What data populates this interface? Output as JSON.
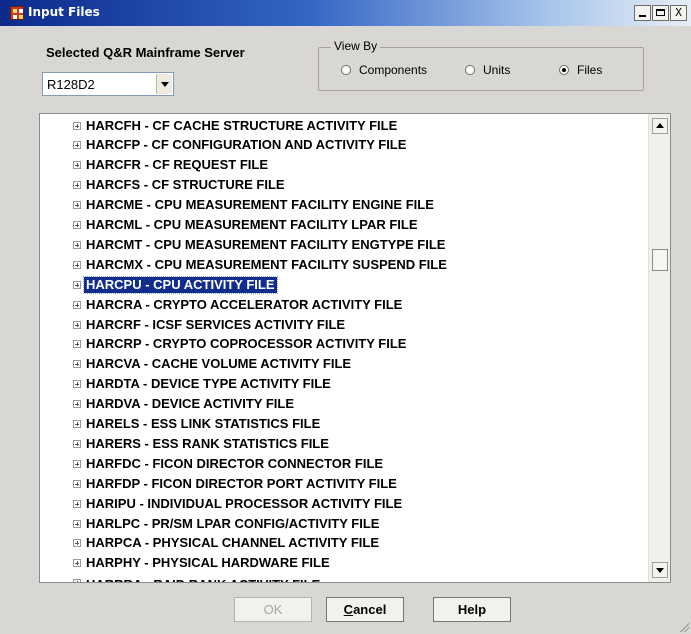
{
  "window": {
    "title": "Input Files",
    "controls": [
      "_",
      "□",
      "X"
    ]
  },
  "server": {
    "label": "Selected Q&R Mainframe Server",
    "selected": "R128D2"
  },
  "view_by": {
    "legend": "View By",
    "options": [
      {
        "label": "Components",
        "checked": false
      },
      {
        "label": "Units",
        "checked": false
      },
      {
        "label": "Files",
        "checked": true
      }
    ]
  },
  "tree": {
    "items": [
      {
        "label": "HARCFH - CF CACHE STRUCTURE ACTIVITY FILE"
      },
      {
        "label": "HARCFP - CF CONFIGURATION AND ACTIVITY FILE"
      },
      {
        "label": "HARCFR - CF REQUEST FILE"
      },
      {
        "label": "HARCFS - CF STRUCTURE FILE"
      },
      {
        "label": "HARCME - CPU MEASUREMENT FACILITY ENGINE FILE"
      },
      {
        "label": "HARCML - CPU MEASUREMENT FACILITY LPAR FILE"
      },
      {
        "label": "HARCMT - CPU MEASUREMENT FACILITY ENGTYPE FILE"
      },
      {
        "label": "HARCMX - CPU MEASUREMENT FACILITY SUSPEND FILE"
      },
      {
        "label": "HARCPU - CPU ACTIVITY FILE",
        "selected": true
      },
      {
        "label": "HARCRA - CRYPTO ACCELERATOR ACTIVITY FILE"
      },
      {
        "label": "HARCRF - ICSF SERVICES ACTIVITY FILE"
      },
      {
        "label": "HARCRP - CRYPTO COPROCESSOR ACTIVITY FILE"
      },
      {
        "label": "HARCVA - CACHE VOLUME ACTIVITY FILE"
      },
      {
        "label": "HARDTA - DEVICE TYPE ACTIVITY FILE"
      },
      {
        "label": "HARDVA - DEVICE ACTIVITY FILE"
      },
      {
        "label": "HARELS - ESS LINK STATISTICS FILE"
      },
      {
        "label": "HARERS - ESS RANK STATISTICS FILE"
      },
      {
        "label": "HARFDC - FICON DIRECTOR CONNECTOR FILE"
      },
      {
        "label": "HARFDP - FICON DIRECTOR PORT ACTIVITY FILE"
      },
      {
        "label": "HARIPU - INDIVIDUAL PROCESSOR ACTIVITY FILE"
      },
      {
        "label": "HARLPC - PR/SM LPAR CONFIG/ACTIVITY FILE"
      },
      {
        "label": "HARPCA - PHYSICAL CHANNEL ACTIVITY FILE"
      },
      {
        "label": "HARPHY - PHYSICAL HARDWARE FILE"
      },
      {
        "label": "HARRRA - RAID RANK ACTIVITY FILE",
        "partial": true
      }
    ]
  },
  "buttons": {
    "ok": "OK",
    "cancel": "Cancel",
    "help": "Help"
  }
}
